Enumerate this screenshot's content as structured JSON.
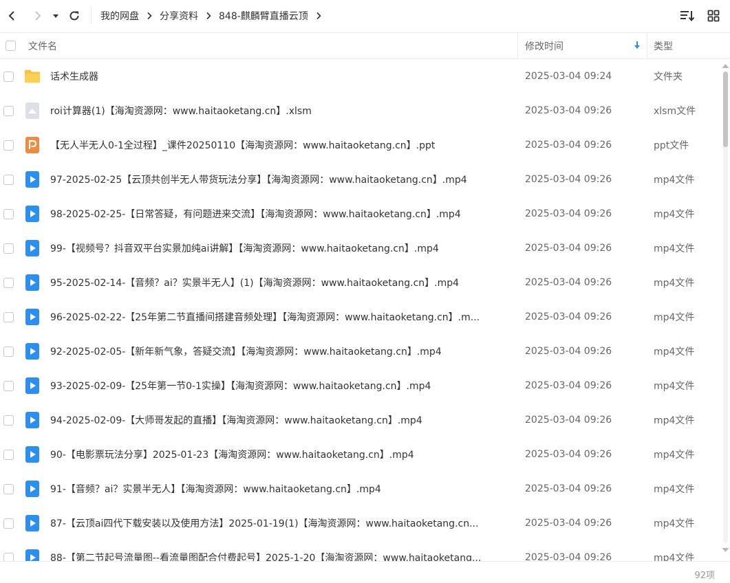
{
  "toolbar": {
    "breadcrumbs": [
      "我的网盘",
      "分享资料",
      "848-麒麟臂直播云顶"
    ]
  },
  "header": {
    "name_label": "文件名",
    "modified_label": "修改时间",
    "type_label": "类型"
  },
  "colors": {
    "accent": "#2b8ef3",
    "folder": "#f6c343",
    "ppt": "#f08a3c",
    "generic": "#d8dde3"
  },
  "files": [
    {
      "icon": "folder-icon",
      "name": "话术生成器",
      "modified": "2025-03-04 09:24",
      "type": "文件夹"
    },
    {
      "icon": "generic-file-icon",
      "name": "roi计算器(1)【海淘资源网：www.haitaoketang.cn】.xlsm",
      "modified": "2025-03-04 09:26",
      "type": "xlsm文件"
    },
    {
      "icon": "ppt-file-icon",
      "name": "【无人半无人0-1全过程】_课件20250110【海淘资源网：www.haitaoketang.cn】.ppt",
      "modified": "2025-03-04 09:26",
      "type": "ppt文件"
    },
    {
      "icon": "video-file-icon",
      "name": "97-2025-02-25【云顶共创半无人带货玩法分享】【海淘资源网：www.haitaoketang.cn】.mp4",
      "modified": "2025-03-04 09:26",
      "type": "mp4文件"
    },
    {
      "icon": "video-file-icon",
      "name": "98-2025-02-25-【日常答疑，有问题进来交流】【海淘资源网：www.haitaoketang.cn】.mp4",
      "modified": "2025-03-04 09:26",
      "type": "mp4文件"
    },
    {
      "icon": "video-file-icon",
      "name": "99-【视频号？抖音双平台实景加纯ai讲解】【海淘资源网：www.haitaoketang.cn】.mp4",
      "modified": "2025-03-04 09:26",
      "type": "mp4文件"
    },
    {
      "icon": "video-file-icon",
      "name": "95-2025-02-14-【音频？ai？实景半无人】(1)【海淘资源网：www.haitaoketang.cn】.mp4",
      "modified": "2025-03-04 09:26",
      "type": "mp4文件"
    },
    {
      "icon": "video-file-icon",
      "name": "96-2025-02-22-【25年第二节直播间搭建音频处理】【海淘资源网：www.haitaoketang.cn】.m...",
      "modified": "2025-03-04 09:26",
      "type": "mp4文件"
    },
    {
      "icon": "video-file-icon",
      "name": "92-2025-02-05-【新年新气象，答疑交流】【海淘资源网：www.haitaoketang.cn】.mp4",
      "modified": "2025-03-04 09:26",
      "type": "mp4文件"
    },
    {
      "icon": "video-file-icon",
      "name": "93-2025-02-09-【25年第一节0-1实操】【海淘资源网：www.haitaoketang.cn】.mp4",
      "modified": "2025-03-04 09:26",
      "type": "mp4文件"
    },
    {
      "icon": "video-file-icon",
      "name": "94-2025-02-09-【大师哥发起的直播】【海淘资源网：www.haitaoketang.cn】.mp4",
      "modified": "2025-03-04 09:26",
      "type": "mp4文件"
    },
    {
      "icon": "video-file-icon",
      "name": "90-【电影票玩法分享】2025-01-23【海淘资源网：www.haitaoketang.cn】.mp4",
      "modified": "2025-03-04 09:26",
      "type": "mp4文件"
    },
    {
      "icon": "video-file-icon",
      "name": "91-【音频？ai？实景半无人】【海淘资源网：www.haitaoketang.cn】.mp4",
      "modified": "2025-03-04 09:26",
      "type": "mp4文件"
    },
    {
      "icon": "video-file-icon",
      "name": "87-【云顶ai四代下载安装以及使用方法】2025-01-19(1)【海淘资源网：www.haitaoketang.cn...",
      "modified": "2025-03-04 09:26",
      "type": "mp4文件"
    },
    {
      "icon": "video-file-icon",
      "name": "88-【第二节起号流量图--看流量图配合付费起号】2025-1-20【海淘资源网：www.haitaoketang...",
      "modified": "2025-03-04 09:26",
      "type": "mp4文件"
    }
  ],
  "footer": {
    "count": "92项"
  }
}
